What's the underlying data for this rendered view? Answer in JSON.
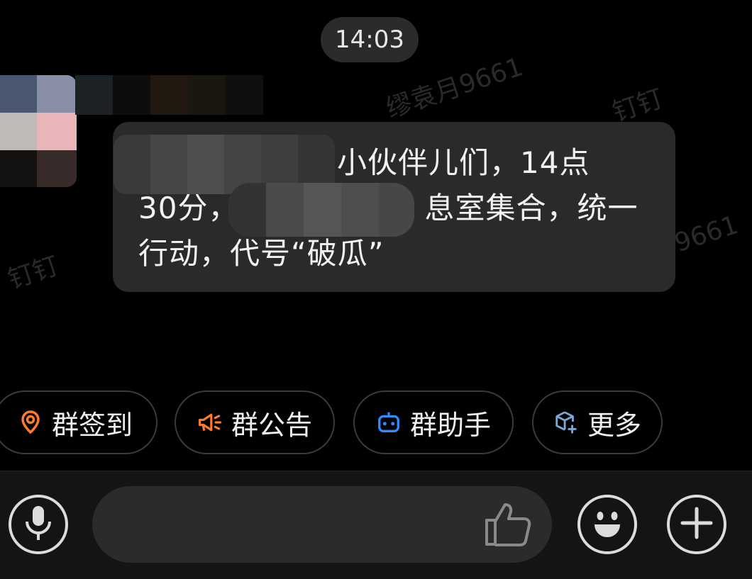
{
  "header": {
    "time": "14:03"
  },
  "watermarks": [
    "缪袁月9661",
    "钉钉",
    "钉钉",
    "9661"
  ],
  "message": {
    "line1": "小伙伴儿们，14点",
    "line2_start": "30分，",
    "line2_end": "息室集合，统一",
    "line3": "行动，代号“破瓜”"
  },
  "quick_actions": [
    {
      "label": "群签到",
      "icon": "location-pin-icon",
      "color": "#ff7a2e"
    },
    {
      "label": "群公告",
      "icon": "megaphone-icon",
      "color": "#ff7a2e"
    },
    {
      "label": "群助手",
      "icon": "robot-icon",
      "color": "#2d8cff"
    },
    {
      "label": "更多",
      "icon": "cube-plus-icon",
      "color": "#7aa7d6"
    }
  ],
  "input": {
    "placeholder": ""
  }
}
